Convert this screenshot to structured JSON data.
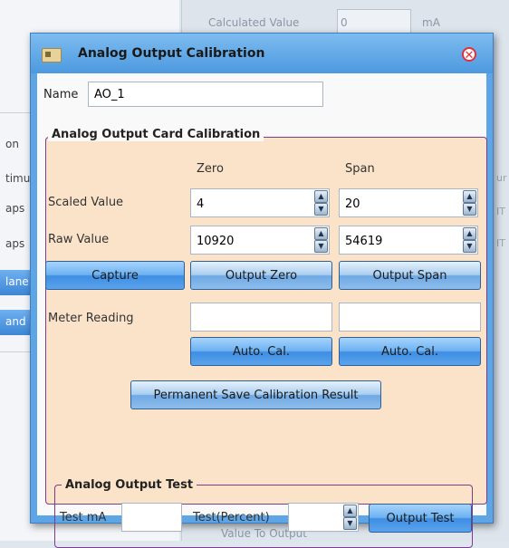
{
  "background": {
    "top_field": {
      "label": "Calculated Value",
      "value": "0",
      "unit": "mA"
    },
    "list_items": [
      "on",
      "timu",
      "aps",
      "aps",
      "lane",
      "and"
    ],
    "right_edge": [
      "ur",
      "IT",
      "IT"
    ],
    "bottom_label": "Value To Output"
  },
  "dialog": {
    "title": "Analog Output Calibration",
    "name_label": "Name",
    "name_value": "AO_1",
    "card_calibration": {
      "title": "Analog Output Card Calibration",
      "col_zero": "Zero",
      "col_span": "Span",
      "scaled_label": "Scaled Value",
      "scaled_zero": "4",
      "scaled_span": "20",
      "raw_label": "Raw Value",
      "raw_zero": "10920",
      "raw_span": "54619",
      "capture_label": "Capture",
      "output_zero_label": "Output Zero",
      "output_span_label": "Output Span",
      "meter_label": "Meter Reading",
      "meter_zero": "",
      "meter_span": "",
      "auto_cal_zero_label": "Auto. Cal.",
      "auto_cal_span_label": "Auto. Cal.",
      "permanent_save_label": "Permanent Save Calibration Result"
    },
    "output_test": {
      "title": "Analog Output Test",
      "test_ma_label": "Test mA",
      "test_ma_value": "",
      "test_percent_label": "Test(Percent)",
      "test_percent_value": "",
      "button_label": "Output Test"
    }
  }
}
